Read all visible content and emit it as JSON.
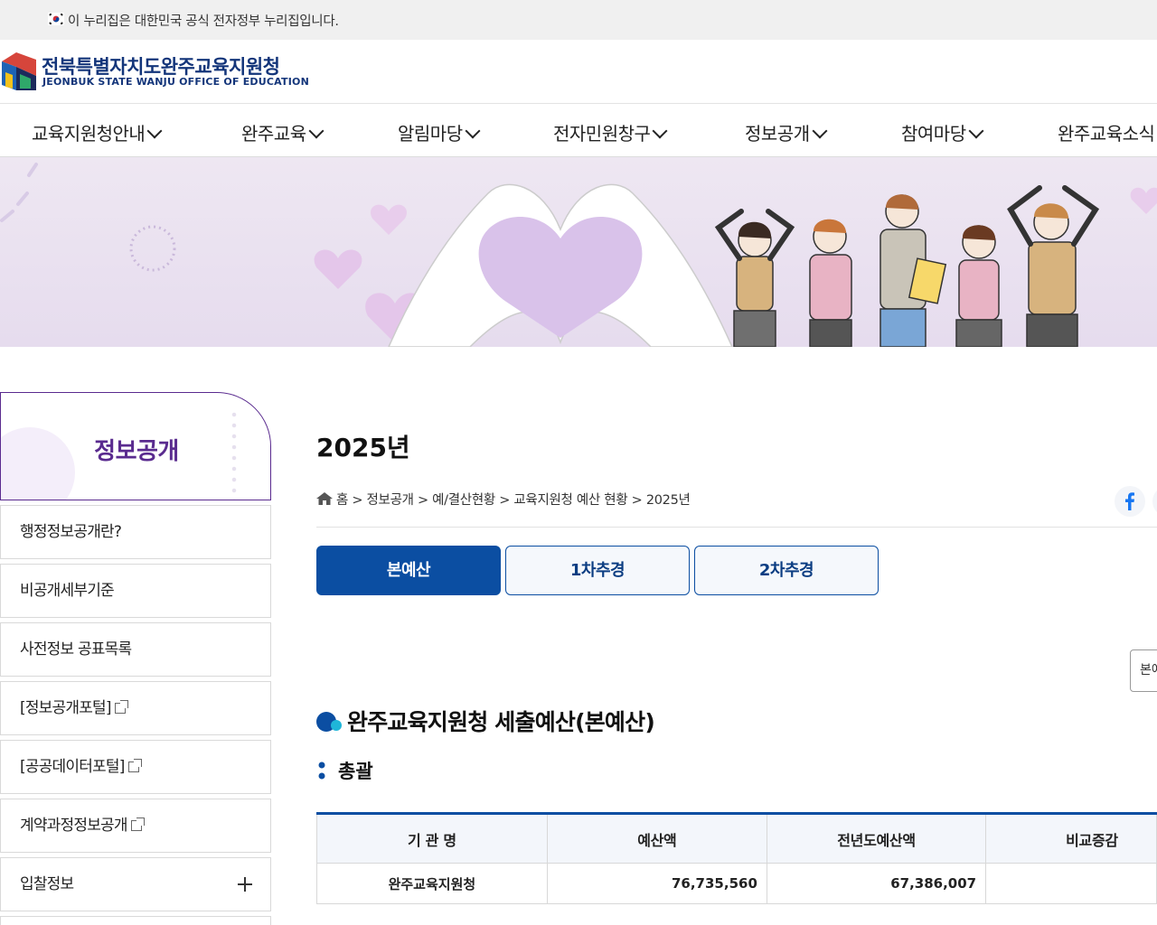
{
  "gov_banner": {
    "text": "이 누리집은 대한민국 공식 전자정부 누리집입니다."
  },
  "logo": {
    "korean": "전북특별자치도완주교육지원청",
    "english": "JEONBUK STATE WANJU OFFICE OF EDUCATION"
  },
  "gnb": {
    "items": [
      {
        "label": "교육지원청안내"
      },
      {
        "label": "완주교육"
      },
      {
        "label": "알림마당"
      },
      {
        "label": "전자민원창구"
      },
      {
        "label": "정보공개"
      },
      {
        "label": "참여마당"
      },
      {
        "label": "완주교육소식"
      }
    ]
  },
  "lnb": {
    "title": "정보공개",
    "items": [
      {
        "label": "행정정보공개란?"
      },
      {
        "label": "비공개세부기준"
      },
      {
        "label": "사전정보 공표목록"
      },
      {
        "label": "[정보공개포털]"
      },
      {
        "label": "[공공데이터포털]"
      },
      {
        "label": "계약과정정보공개"
      },
      {
        "label": "입찰정보"
      }
    ]
  },
  "content": {
    "title": "2025년",
    "breadcrumb": "홈 > 정보공개 > 예/결산현황 > 교육지원청 예산 현황 > 2025년",
    "tabs": [
      {
        "label": "본예산"
      },
      {
        "label": "1차추경"
      },
      {
        "label": "2차추경"
      }
    ],
    "unit_button": "본예산",
    "section_title": "완주교육지원청 세출예산(본예산)",
    "sub_title": "총괄",
    "table": {
      "headers": [
        "기 관 명",
        "예산액",
        "전년도예산액",
        "비교증감"
      ],
      "rows": [
        [
          "완주교육지원청",
          "76,735,560",
          "67,386,007",
          ""
        ]
      ]
    }
  },
  "colors": {
    "brand_blue": "#0b4ea2",
    "lnb_purple": "#5a2b8f",
    "logo_navy": "#13357a"
  }
}
